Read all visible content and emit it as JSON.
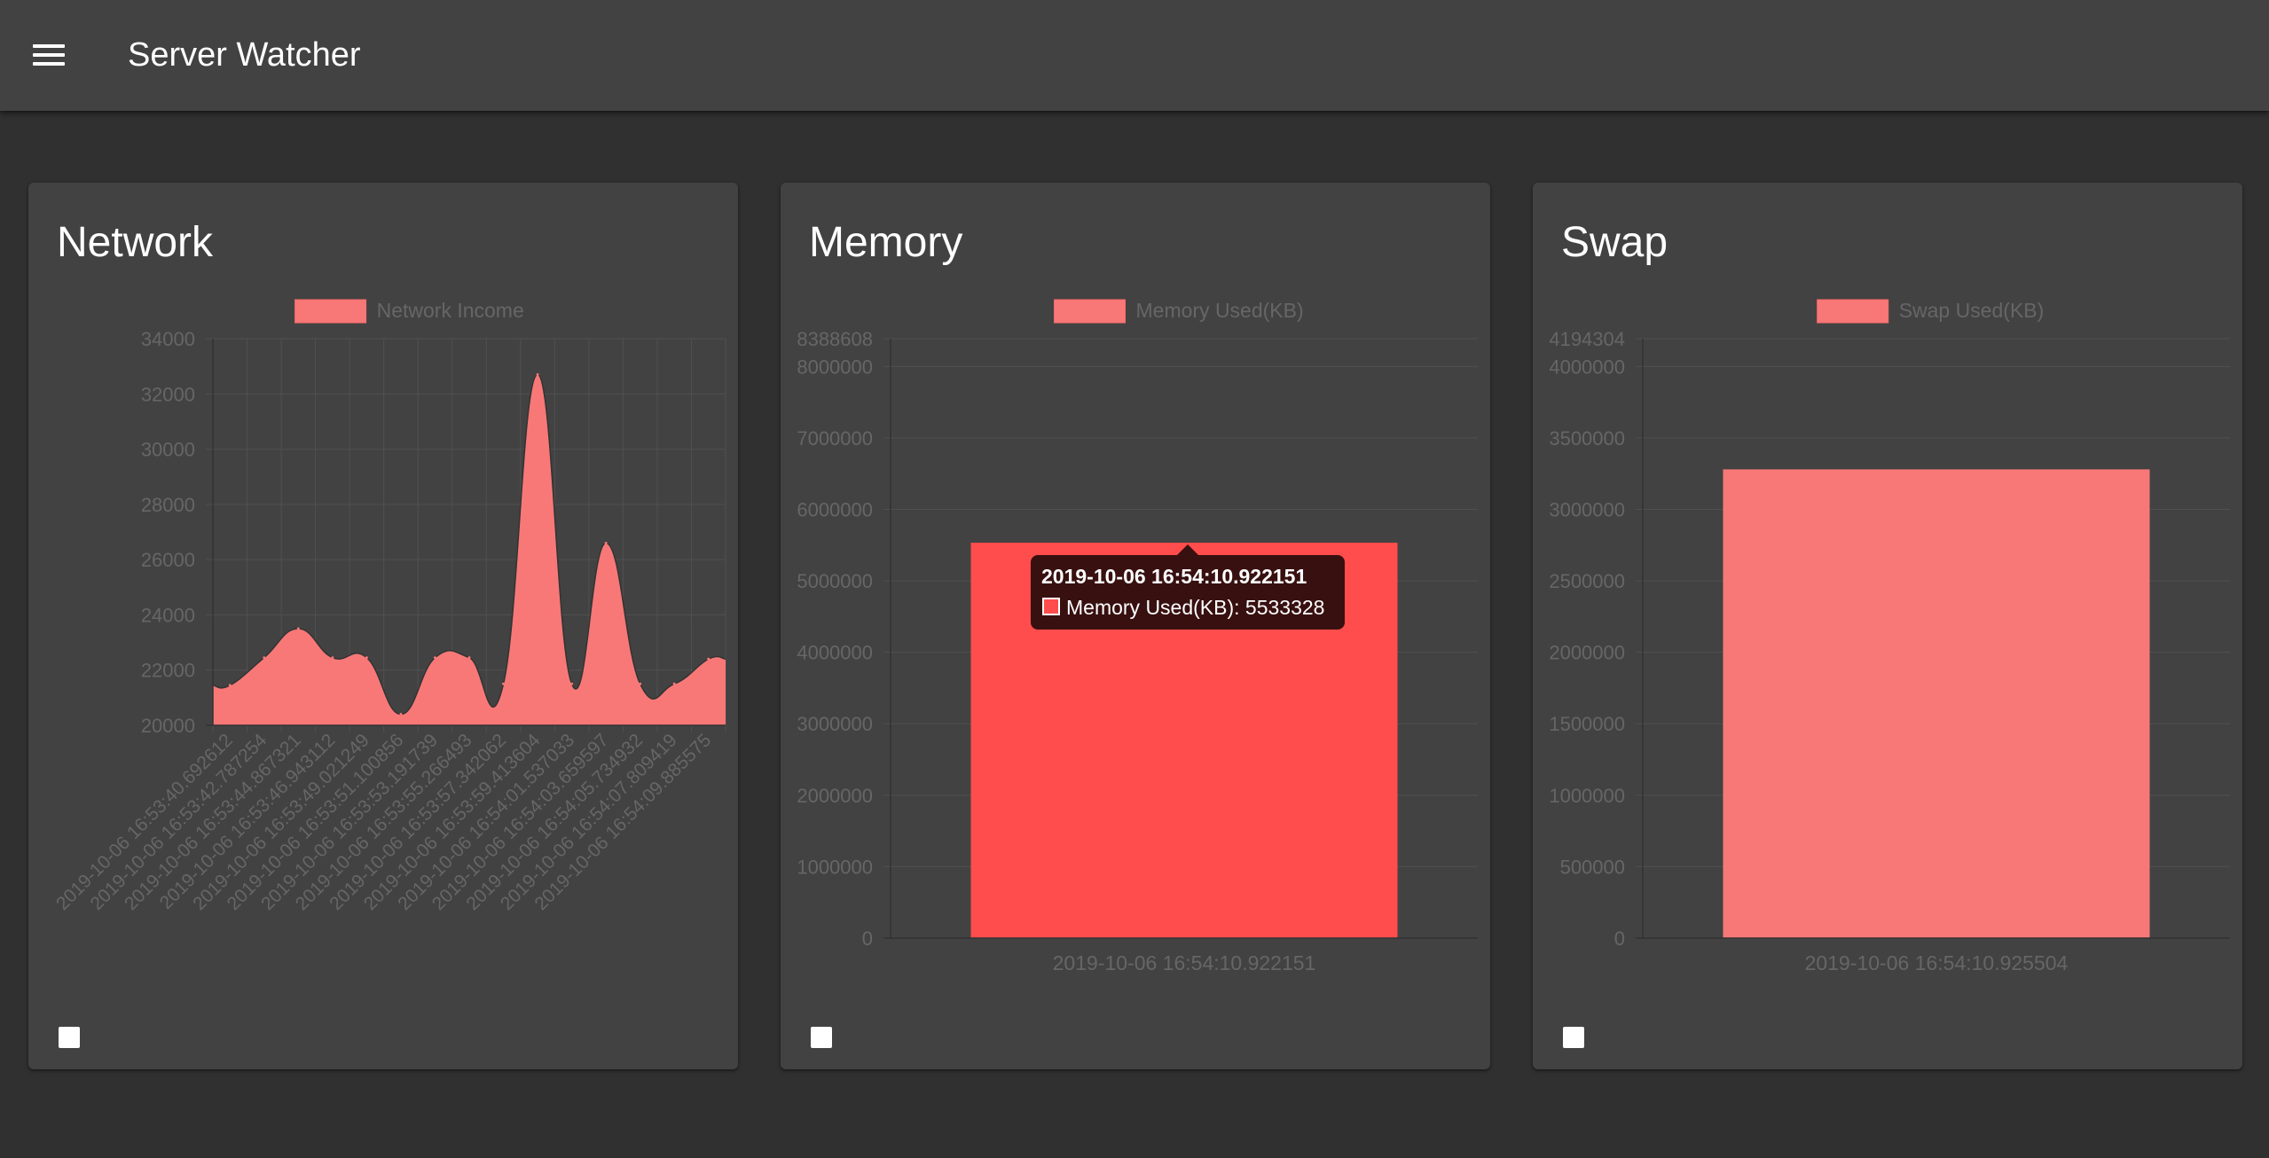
{
  "app": {
    "title": "Server Watcher"
  },
  "colors": {
    "background": "#303030",
    "surface": "#424242",
    "series_fill": "#f87878",
    "series_hover_fill": "#ff4c4c",
    "muted_text": "#666666",
    "grid": "#505050"
  },
  "cards": [
    {
      "title": "Network"
    },
    {
      "title": "Memory"
    },
    {
      "title": "Swap"
    }
  ],
  "tooltip": {
    "title": "2019-10-06 16:54:10.922151",
    "series": "Memory Used(KB)",
    "value": "5533328",
    "body": "Memory Used(KB): 5533328"
  },
  "chart_data": [
    {
      "type": "area",
      "legend": "Network Income",
      "legend_position": "top",
      "grid": true,
      "x": [
        "2019-10-06 16:53:40.692612",
        "2019-10-06 16:53:42.787254",
        "2019-10-06 16:53:44.867321",
        "2019-10-06 16:53:46.943112",
        "2019-10-06 16:53:49.021249",
        "2019-10-06 16:53:51.100856",
        "2019-10-06 16:53:53.191739",
        "2019-10-06 16:53:55.266493",
        "2019-10-06 16:53:57.342062",
        "2019-10-06 16:53:59.413604",
        "2019-10-06 16:54:01.537033",
        "2019-10-06 16:54:03.659597",
        "2019-10-06 16:54:05.734932",
        "2019-10-06 16:54:07.809419",
        "2019-10-06 16:54:09.885575"
      ],
      "values": [
        21450,
        22450,
        23500,
        22450,
        22450,
        20400,
        22450,
        22450,
        21500,
        32700,
        21500,
        26600,
        21500,
        21500,
        22400
      ],
      "ylim": [
        20000,
        34000
      ],
      "yticks": [
        "34000",
        "32000",
        "30000",
        "28000",
        "26000",
        "24000",
        "22000",
        "20000"
      ]
    },
    {
      "type": "bar",
      "legend": "Memory Used(KB)",
      "legend_position": "top",
      "grid": true,
      "categories": [
        "2019-10-06 16:54:10.922151"
      ],
      "values": [
        5533328
      ],
      "ylim": [
        0,
        8388608
      ],
      "yticks": [
        "8388608",
        "8000000",
        "7000000",
        "6000000",
        "5000000",
        "4000000",
        "3000000",
        "2000000",
        "1000000",
        "0"
      ],
      "highlighted": true
    },
    {
      "type": "bar",
      "legend": "Swap Used(KB)",
      "legend_position": "top",
      "grid": true,
      "categories": [
        "2019-10-06 16:54:10.925504"
      ],
      "values": [
        3280000
      ],
      "ylim": [
        0,
        4194304
      ],
      "yticks": [
        "4194304",
        "4000000",
        "3500000",
        "3000000",
        "2500000",
        "2000000",
        "1500000",
        "1000000",
        "500000",
        "0"
      ],
      "highlighted": false
    }
  ]
}
